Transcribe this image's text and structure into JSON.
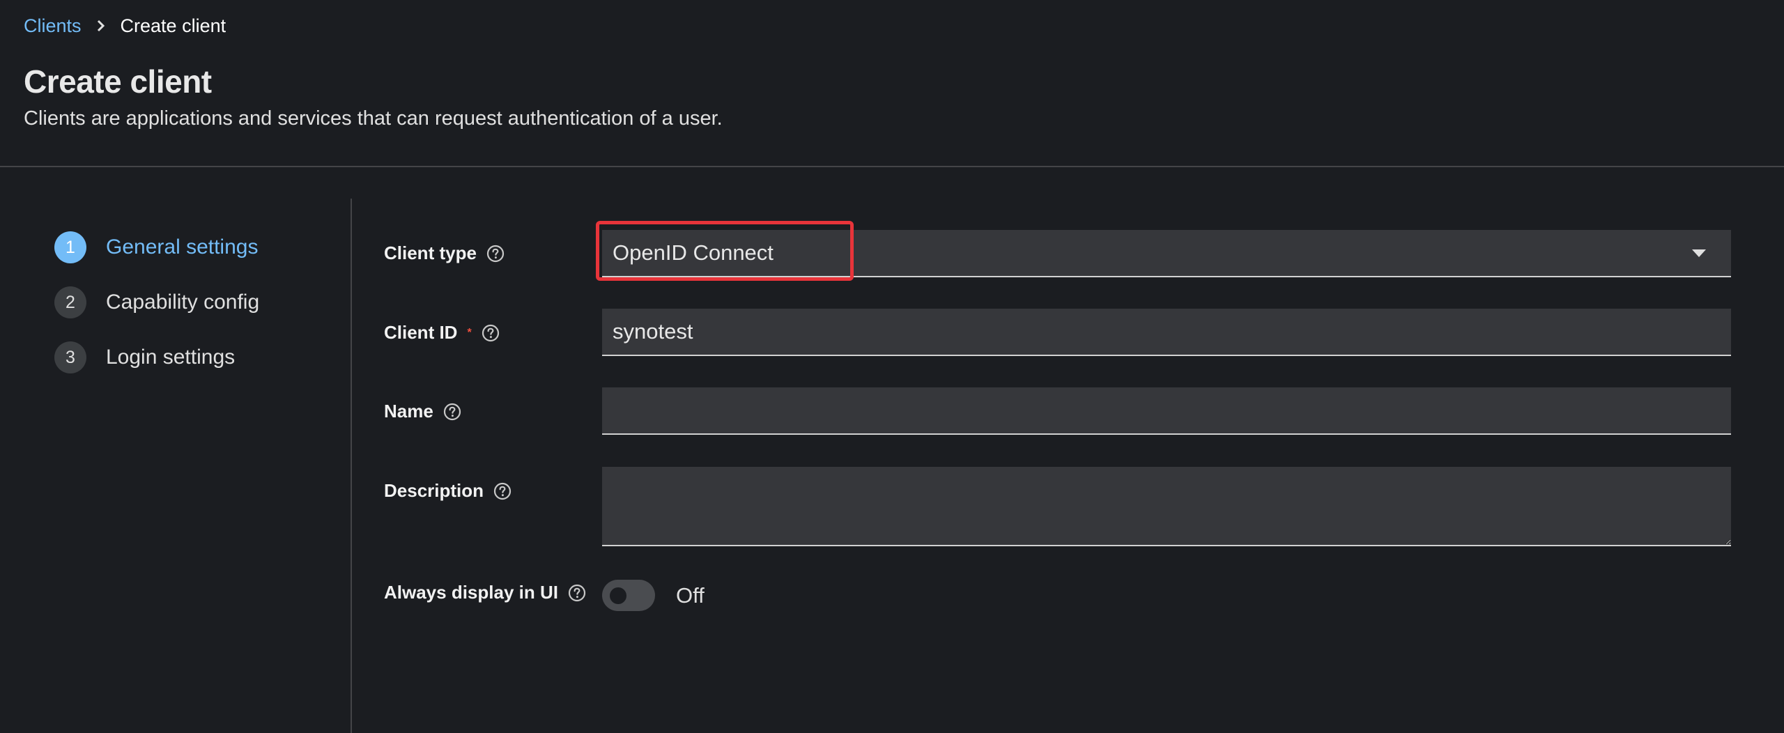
{
  "breadcrumb": {
    "parent": "Clients",
    "current": "Create client"
  },
  "page": {
    "title": "Create client",
    "subtitle": "Clients are applications and services that can request authentication of a user."
  },
  "wizard": {
    "steps": [
      {
        "number": "1",
        "label": "General settings",
        "active": true
      },
      {
        "number": "2",
        "label": "Capability config",
        "active": false
      },
      {
        "number": "3",
        "label": "Login settings",
        "active": false
      }
    ]
  },
  "form": {
    "client_type": {
      "label": "Client type",
      "value": "OpenID Connect"
    },
    "client_id": {
      "label": "Client ID",
      "required_mark": "*",
      "value": "synotest"
    },
    "name": {
      "label": "Name",
      "value": ""
    },
    "description": {
      "label": "Description",
      "value": ""
    },
    "always_display": {
      "label": "Always display in UI",
      "state": "Off"
    }
  },
  "colors": {
    "accent": "#73bcf7",
    "highlight": "#e8343a",
    "required": "#f0503f"
  },
  "icons": {
    "help": "help-circle-icon",
    "breadcrumb_separator": "chevron-right-icon",
    "select_caret": "caret-down-icon"
  }
}
